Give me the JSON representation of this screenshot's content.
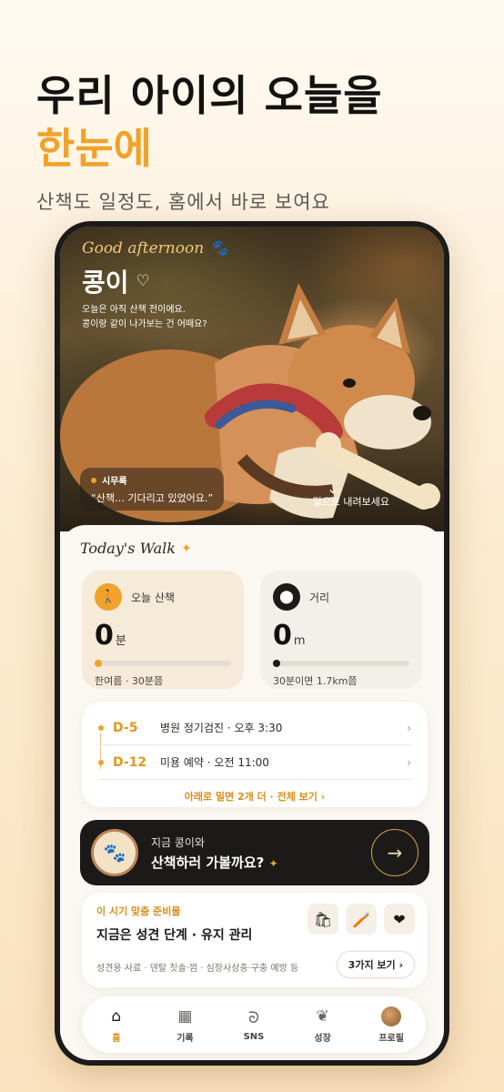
{
  "hero": {
    "line1": "우리 아이의 오늘을",
    "line2": "한눈에",
    "sub": "산책도 일정도, 홈에서 바로 보여요"
  },
  "header": {
    "greeting": "Good afternoon",
    "dog_name": "콩이",
    "message_line1": "오늘은 아직 산책 전이에요.",
    "message_line2": "콩이랑 같이 나가보는 건 어때요?",
    "bubble_name": "시무룩",
    "bubble_text": "“산책… 기다리고 있었어요.”",
    "scroll_hint": "밑으로 내려보세요"
  },
  "today": {
    "title": "Today's Walk",
    "walk": {
      "label": "오늘 산책",
      "value": "0",
      "unit": "분",
      "note": "한여름 · 30분쯤",
      "progress": 0
    },
    "distance": {
      "label": "거리",
      "value": "0",
      "unit": "m",
      "note": "30분이면 1.7km쯤",
      "progress": 0
    }
  },
  "schedule": {
    "items": [
      {
        "d": "D-5",
        "text": "병원 정기검진 · 오후 3:30"
      },
      {
        "d": "D-12",
        "text": "미용 예약 · 오전 11:00"
      }
    ],
    "more": "아래로 밀면 2개 더 · 전체 보기 ›"
  },
  "cta": {
    "line1": "지금 콩이와",
    "line2": "산책하러 가볼까요?"
  },
  "season": {
    "tag": "이 시기 맞춤 준비물",
    "title": "지금은 성견 단계 · 유지 관리",
    "desc": "성견용 사료 · 덴탈 칫솔·껌 · 심장사상충·구충 예방 등",
    "button": "3가지 보기 ›"
  },
  "tabs": [
    {
      "label": "홈",
      "icon": "home-icon"
    },
    {
      "label": "기록",
      "icon": "grid-icon"
    },
    {
      "label": "SNS",
      "icon": "sns-icon"
    },
    {
      "label": "성장",
      "icon": "sprout-icon"
    },
    {
      "label": "프로필",
      "icon": "avatar-icon"
    }
  ],
  "colors": {
    "accent": "#f0a229",
    "dark": "#1c1a18"
  }
}
